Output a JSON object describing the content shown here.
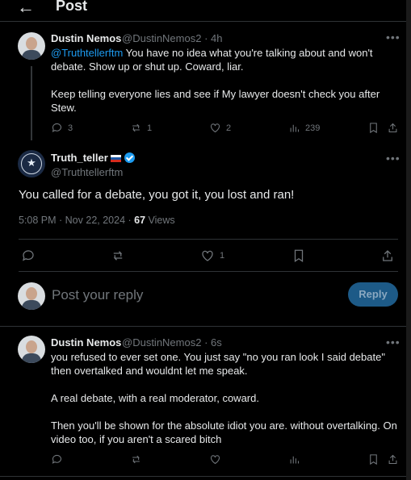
{
  "header": {
    "back_icon": "arrow-left-icon",
    "title": "Post"
  },
  "parent_post": {
    "name": "Dustin Nemos",
    "handle_time": "@DustinNemos2 · 4h",
    "mention": "@Truthtellerftm",
    "line1_rest": " You have no idea what you're talking about and won't",
    "line2": "debate. Show up or shut up. Coward, liar.",
    "line3": "Keep telling everyone lies and see if My lawyer doesn't check you after",
    "line4": "Stew.",
    "replies": "3",
    "reposts": "1",
    "likes": "2",
    "views": "239"
  },
  "main_post": {
    "name": "Truth_teller",
    "handle": "@Truthtellerftm",
    "text": "You called for a debate, you got it, you lost and ran!",
    "time": "5:08 PM · Nov 22, 2024 · ",
    "views_count": "67",
    "views_label": " Views",
    "likes": "1"
  },
  "reply_box": {
    "placeholder": "Post your reply",
    "button": "Reply"
  },
  "reply_post": {
    "name": "Dustin Nemos",
    "handle_time": "@DustinNemos2 · 6s",
    "line1": "you refused to ever set one. You just say \"no you ran look I said debate\"",
    "line2": "then overtalked and wouldnt let me speak.",
    "line3": "A real debate, with a real moderator, coward.",
    "line4": "Then you'll be shown for the absolute idiot you are. without overtalking. On",
    "line5": "video too, if you aren't a scared bitch"
  },
  "colors": {
    "accent": "#1d9bf0",
    "muted": "#71767b",
    "background": "#000000"
  }
}
